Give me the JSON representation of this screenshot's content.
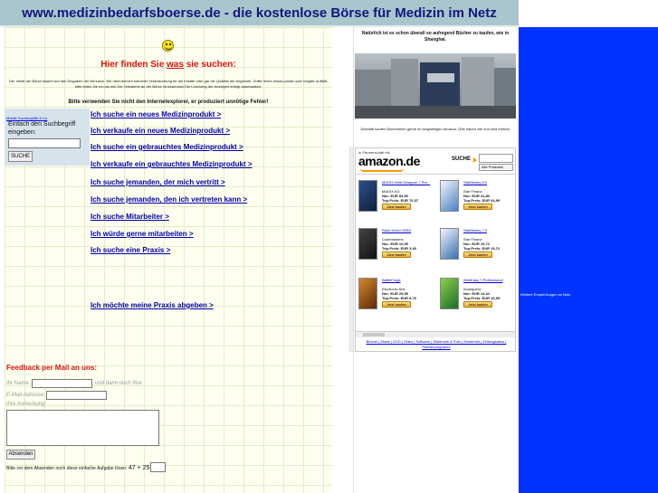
{
  "header": {
    "title": "www.medizinbedarfsboerse.de - die kostenlose Börse für Medizin im Netz"
  },
  "main": {
    "headline_pre": "Hier finden Sie ",
    "headline_u": "was",
    "headline_post": " sie suchen:",
    "disclaimer": "Der Inhalt der Börse basiert auf den Eingaben der Benutzer. Wir übernehmen keinerlei Verantwortung für die Inhalte oder gar die Qualität der Angebote. Sollte Ihnen etwas positiv oder negativ auffallt, bitte teilen Sie es uns mit! Die Teilnahme an der Börse ist kostenlos! Die Löschung der Anzeigen erfolgt automatisch.",
    "browser_note": "Bitte verwenden Sie nicht den Internetexplorer, er produziert unnötige Fehler!"
  },
  "search": {
    "partner_link": "Mobile Suchbegriffe & Co",
    "label": "Einfach den Suchbegriff eingeben:",
    "button": "SUCHE"
  },
  "menu": [
    "Ich suche ein neues Medizinprodukt >",
    "Ich verkaufe ein neues Medizinprodukt >",
    "Ich suche ein gebrauchtes Medizinprodukt >",
    "Ich verkaufe ein gebrauchtes Medizinprodukt >",
    "Ich suche jemanden, der mich vertritt >",
    "Ich suche jemanden, den ich vertreten kann >",
    "Ich suche Mitarbeiter >",
    "Ich würde gerne mitarbeiten >",
    "Ich suche eine Praxis >",
    "Ich möchte meine Praxis abgeben >"
  ],
  "feedback": {
    "title": "Feedback per Mail an uns:",
    "name_label": "Ihr Name:",
    "name_suffix": "und dann noch Ihre",
    "email_label": "E-Mail-Adresse:",
    "note_label": "Ihre Anmerkung:",
    "send_button": "Absenden",
    "captcha_text": "Bitte vor dem Absenden noch diese einfache Aufgabe lösen:",
    "captcha_math": "47 + 25 ="
  },
  "ads": {
    "text1": "Natürlich ist es schon überall so aufregend Bücher zu kaufen, wie in Shanghai.",
    "text2": "Deshalb kaufen Büchershen gerne im langweiligen Amazon: (Die haben viel und sind ehrlich)",
    "amazon": {
      "partner": "In Partnerschaft mit",
      "logo": "amazon",
      "tld": ".de",
      "search": "SUCHE",
      "select": "Alle Produkte",
      "products": [
        {
          "name": "MAGIX Web Designer 7 Pre...",
          "maker": "MAGIX AG",
          "price": "Nur: EUR 84,90",
          "top": "Top-Preis: EUR 76,37",
          "buy": "Jetzt kaufen"
        },
        {
          "name": "StarMoney 8.0",
          "maker": "Star Finanz",
          "price": "Nur: EUR 41,80",
          "top": "Top-Preis: EUR 34,99",
          "buy": "Jetzt kaufen"
        },
        {
          "name": "Race Driver GRID",
          "maker": "Codemasters",
          "price": "Nur: EUR 10,99",
          "top": "Top-Preis: EUR 3,49",
          "buy": "Jetzt kaufen"
        },
        {
          "name": "StarMoney 7.0",
          "maker": "Star Finanz",
          "price": "Nur: EUR 19,72",
          "top": "Top-Preis: EUR 19,72",
          "buy": "Jetzt kaufen"
        },
        {
          "name": "BattleForge",
          "maker": "Electronic Arts",
          "price": "Nur: EUR 29,99",
          "top": "Top-Preis: EUR 8,70",
          "buy": "Jetzt kaufen"
        },
        {
          "name": "WebEasy 7 Professional",
          "maker": "Avanquest",
          "price": "Nur: EUR 14,44",
          "top": "Top-Preis: EUR 10,99",
          "buy": "Jetzt kaufen"
        }
      ],
      "footer": "Bücher | Musik | DVD | Video | Software | Elektronik & Foto | Sicherheit | Zeitungsabos | Partnerprogramm"
    }
  },
  "right": {
    "text": "Weitere Empfehlungen im Netz"
  }
}
